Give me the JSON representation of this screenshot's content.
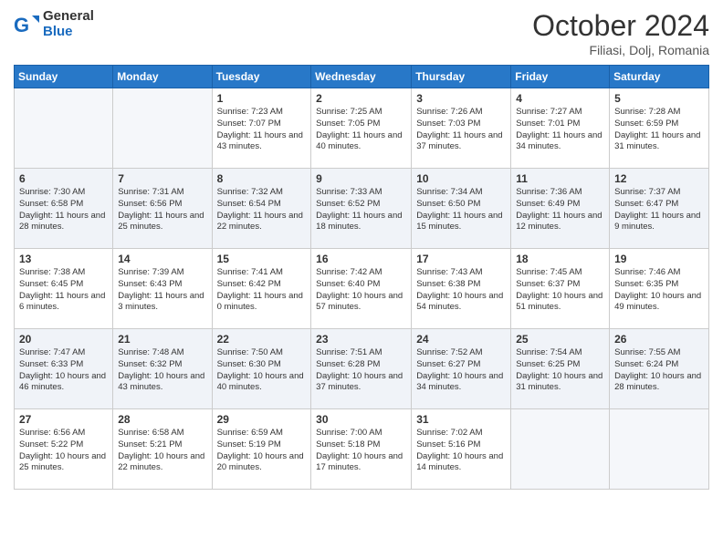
{
  "logo": {
    "general": "General",
    "blue": "Blue"
  },
  "header": {
    "month": "October 2024",
    "location": "Filiasi, Dolj, Romania"
  },
  "weekdays": [
    "Sunday",
    "Monday",
    "Tuesday",
    "Wednesday",
    "Thursday",
    "Friday",
    "Saturday"
  ],
  "rows": [
    [
      {
        "day": "",
        "info": ""
      },
      {
        "day": "",
        "info": ""
      },
      {
        "day": "1",
        "info": "Sunrise: 7:23 AM\nSunset: 7:07 PM\nDaylight: 11 hours and 43 minutes."
      },
      {
        "day": "2",
        "info": "Sunrise: 7:25 AM\nSunset: 7:05 PM\nDaylight: 11 hours and 40 minutes."
      },
      {
        "day": "3",
        "info": "Sunrise: 7:26 AM\nSunset: 7:03 PM\nDaylight: 11 hours and 37 minutes."
      },
      {
        "day": "4",
        "info": "Sunrise: 7:27 AM\nSunset: 7:01 PM\nDaylight: 11 hours and 34 minutes."
      },
      {
        "day": "5",
        "info": "Sunrise: 7:28 AM\nSunset: 6:59 PM\nDaylight: 11 hours and 31 minutes."
      }
    ],
    [
      {
        "day": "6",
        "info": "Sunrise: 7:30 AM\nSunset: 6:58 PM\nDaylight: 11 hours and 28 minutes."
      },
      {
        "day": "7",
        "info": "Sunrise: 7:31 AM\nSunset: 6:56 PM\nDaylight: 11 hours and 25 minutes."
      },
      {
        "day": "8",
        "info": "Sunrise: 7:32 AM\nSunset: 6:54 PM\nDaylight: 11 hours and 22 minutes."
      },
      {
        "day": "9",
        "info": "Sunrise: 7:33 AM\nSunset: 6:52 PM\nDaylight: 11 hours and 18 minutes."
      },
      {
        "day": "10",
        "info": "Sunrise: 7:34 AM\nSunset: 6:50 PM\nDaylight: 11 hours and 15 minutes."
      },
      {
        "day": "11",
        "info": "Sunrise: 7:36 AM\nSunset: 6:49 PM\nDaylight: 11 hours and 12 minutes."
      },
      {
        "day": "12",
        "info": "Sunrise: 7:37 AM\nSunset: 6:47 PM\nDaylight: 11 hours and 9 minutes."
      }
    ],
    [
      {
        "day": "13",
        "info": "Sunrise: 7:38 AM\nSunset: 6:45 PM\nDaylight: 11 hours and 6 minutes."
      },
      {
        "day": "14",
        "info": "Sunrise: 7:39 AM\nSunset: 6:43 PM\nDaylight: 11 hours and 3 minutes."
      },
      {
        "day": "15",
        "info": "Sunrise: 7:41 AM\nSunset: 6:42 PM\nDaylight: 11 hours and 0 minutes."
      },
      {
        "day": "16",
        "info": "Sunrise: 7:42 AM\nSunset: 6:40 PM\nDaylight: 10 hours and 57 minutes."
      },
      {
        "day": "17",
        "info": "Sunrise: 7:43 AM\nSunset: 6:38 PM\nDaylight: 10 hours and 54 minutes."
      },
      {
        "day": "18",
        "info": "Sunrise: 7:45 AM\nSunset: 6:37 PM\nDaylight: 10 hours and 51 minutes."
      },
      {
        "day": "19",
        "info": "Sunrise: 7:46 AM\nSunset: 6:35 PM\nDaylight: 10 hours and 49 minutes."
      }
    ],
    [
      {
        "day": "20",
        "info": "Sunrise: 7:47 AM\nSunset: 6:33 PM\nDaylight: 10 hours and 46 minutes."
      },
      {
        "day": "21",
        "info": "Sunrise: 7:48 AM\nSunset: 6:32 PM\nDaylight: 10 hours and 43 minutes."
      },
      {
        "day": "22",
        "info": "Sunrise: 7:50 AM\nSunset: 6:30 PM\nDaylight: 10 hours and 40 minutes."
      },
      {
        "day": "23",
        "info": "Sunrise: 7:51 AM\nSunset: 6:28 PM\nDaylight: 10 hours and 37 minutes."
      },
      {
        "day": "24",
        "info": "Sunrise: 7:52 AM\nSunset: 6:27 PM\nDaylight: 10 hours and 34 minutes."
      },
      {
        "day": "25",
        "info": "Sunrise: 7:54 AM\nSunset: 6:25 PM\nDaylight: 10 hours and 31 minutes."
      },
      {
        "day": "26",
        "info": "Sunrise: 7:55 AM\nSunset: 6:24 PM\nDaylight: 10 hours and 28 minutes."
      }
    ],
    [
      {
        "day": "27",
        "info": "Sunrise: 6:56 AM\nSunset: 5:22 PM\nDaylight: 10 hours and 25 minutes."
      },
      {
        "day": "28",
        "info": "Sunrise: 6:58 AM\nSunset: 5:21 PM\nDaylight: 10 hours and 22 minutes."
      },
      {
        "day": "29",
        "info": "Sunrise: 6:59 AM\nSunset: 5:19 PM\nDaylight: 10 hours and 20 minutes."
      },
      {
        "day": "30",
        "info": "Sunrise: 7:00 AM\nSunset: 5:18 PM\nDaylight: 10 hours and 17 minutes."
      },
      {
        "day": "31",
        "info": "Sunrise: 7:02 AM\nSunset: 5:16 PM\nDaylight: 10 hours and 14 minutes."
      },
      {
        "day": "",
        "info": ""
      },
      {
        "day": "",
        "info": ""
      }
    ]
  ]
}
